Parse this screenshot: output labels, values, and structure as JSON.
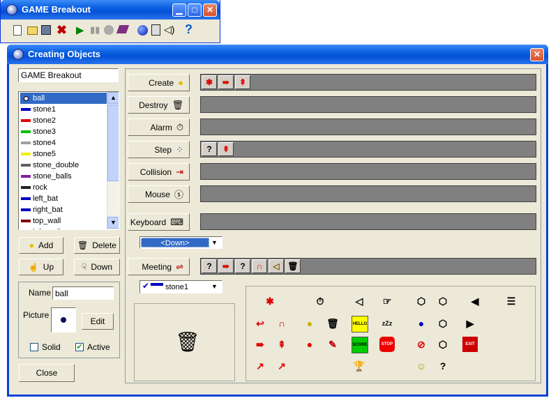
{
  "main_window": {
    "title": "GAME Breakout",
    "toolbar_icons": [
      "new-icon",
      "open-icon",
      "save-icon",
      "delete-icon",
      "run-icon",
      "pause-icon",
      "stop-icon",
      "eraser-icon",
      "sprite-icon",
      "calculator-icon",
      "sound-icon",
      "help-icon"
    ]
  },
  "dialog": {
    "title": "Creating Objects",
    "game_name": "GAME Breakout",
    "objects": [
      {
        "label": "ball",
        "color": "#000000",
        "selected": true
      },
      {
        "label": "stone1",
        "color": "#0000c0"
      },
      {
        "label": "stone2",
        "color": "#e00000"
      },
      {
        "label": "stone3",
        "color": "#00c000"
      },
      {
        "label": "stone4",
        "color": "#a0a0a0"
      },
      {
        "label": "stone5",
        "color": "#f0f000"
      },
      {
        "label": "stone_double",
        "color": "#606060"
      },
      {
        "label": "stone_balls",
        "color": "#8020a0"
      },
      {
        "label": "rock",
        "color": "#202020"
      },
      {
        "label": "left_bat",
        "color": "#0000c0"
      },
      {
        "label": "right_bat",
        "color": "#0000c0"
      },
      {
        "label": "top_wall",
        "color": "#800000"
      },
      {
        "label": "left_wall",
        "color": "#800000"
      }
    ],
    "buttons": {
      "add": "Add",
      "delete": "Delete",
      "up": "Up",
      "down": "Down",
      "edit": "Edit",
      "close": "Close"
    },
    "props": {
      "name_label": "Name",
      "name_value": "ball",
      "picture_label": "Picture",
      "solid_label": "Solid",
      "solid_checked": false,
      "active_label": "Active",
      "active_checked": true
    },
    "events": [
      {
        "label": "Create",
        "icon": "lightbulb-icon",
        "actions": [
          "✱",
          "➠",
          "⇞"
        ]
      },
      {
        "label": "Destroy",
        "icon": "trash-icon",
        "actions": []
      },
      {
        "label": "Alarm",
        "icon": "clock-icon",
        "actions": []
      },
      {
        "label": "Step",
        "icon": "footsteps-icon",
        "actions": [
          "?",
          "⇞"
        ]
      },
      {
        "label": "Collision",
        "icon": "collision-icon",
        "actions": []
      },
      {
        "label": "Mouse",
        "icon": "mouse-icon",
        "actions": []
      },
      {
        "label": "Keyboard",
        "icon": "keyboard-icon",
        "actions": []
      },
      {
        "label": "Meeting",
        "icon": "meeting-icon",
        "actions": [
          "?",
          "➠",
          "?",
          "∩",
          "◁",
          "🗑"
        ]
      }
    ],
    "keyboard_select": "<Down>",
    "meeting_select": "stone1"
  }
}
